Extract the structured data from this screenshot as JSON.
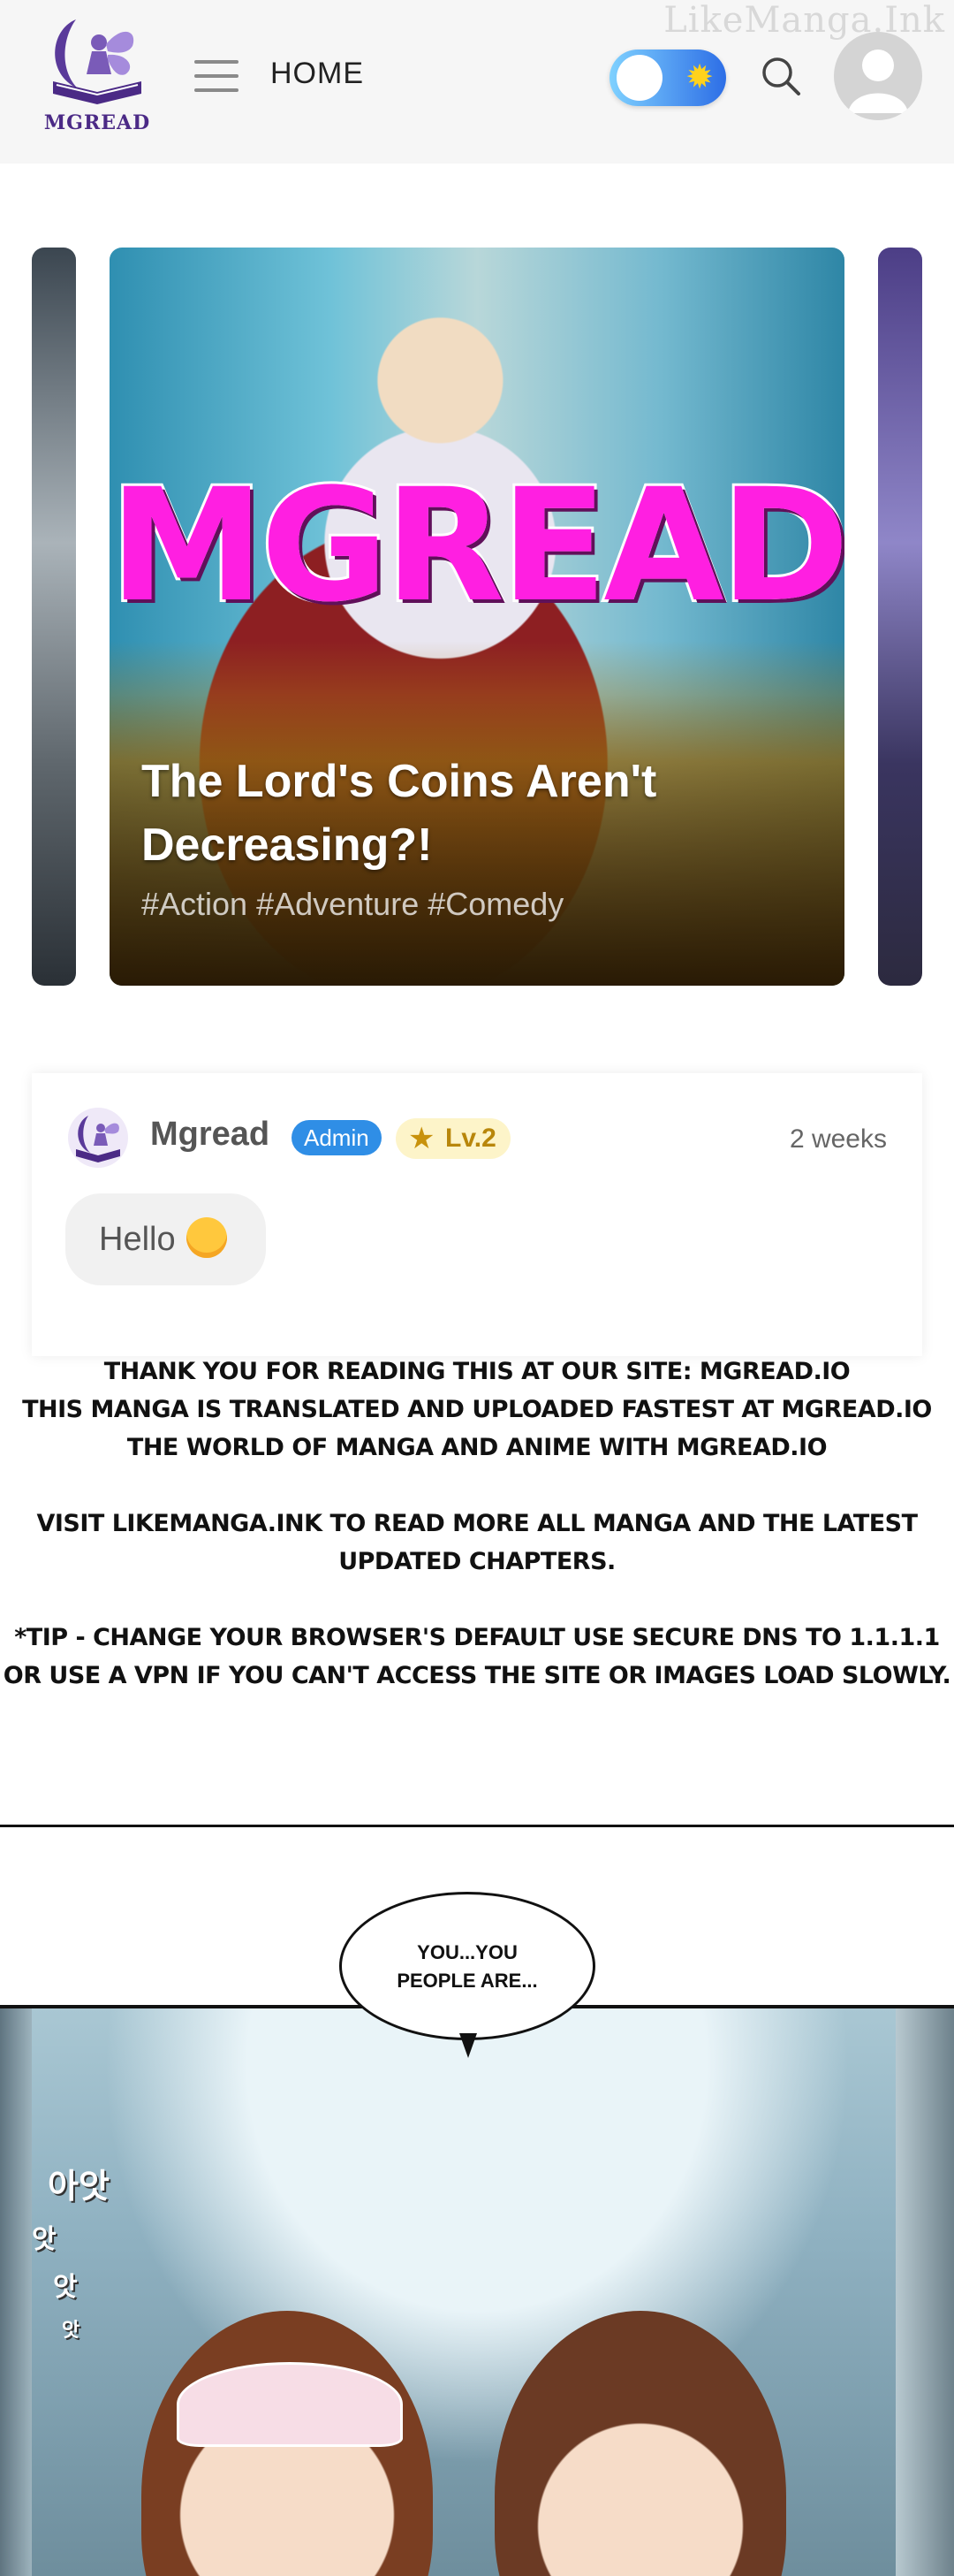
{
  "header": {
    "logo_text": "MGREAD",
    "home_label": "HOME",
    "watermark": "LikeManga.Ink",
    "colors": {
      "toggle_gradient_start": "#7fd1ff",
      "toggle_gradient_end": "#2d6ee6",
      "logo": "#4b2a86"
    }
  },
  "carousel": {
    "main_slide": {
      "title": "The Lord's Coins Aren't Decreasing?!",
      "tags": "#Action #Adventure #Comedy",
      "overlay_text": "MGREAD.IO"
    }
  },
  "comment": {
    "username": "Mgread",
    "role_badge": "Admin",
    "level_badge": "Lv.2",
    "time": "2 weeks",
    "message": "Hello"
  },
  "notice": {
    "line1": "Thank you for reading this at our site: mgread.io",
    "line2": "This manga is translated and uploaded fastest at mgread.io",
    "line3": "The world of manga and anime with mgread.io",
    "line4": "Visit likemanga.ink to read more all manga and the latest updated chapters.",
    "line5": "*Tip - change your browser's default use secure DNS to 1.1.1.1",
    "line6": "or use a VPN if you can't access the site or images load slowly."
  },
  "panel": {
    "speech": "YOU...YOU\nPEOPLE ARE...",
    "sfx1": "아앗",
    "sfx2": "앗",
    "sfx3": "앗",
    "sfx4": "앗"
  }
}
